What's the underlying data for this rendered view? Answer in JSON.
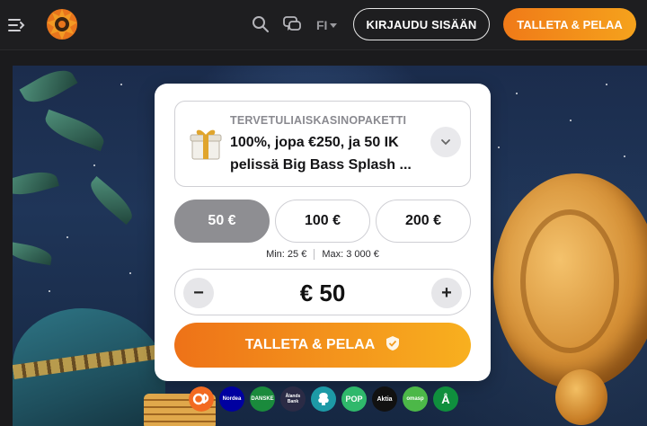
{
  "header": {
    "language": "FI",
    "login_label": "KIRJAUDU SISÄÄN",
    "cta_label": "TALLETA & PELAA",
    "icons": [
      "menu-icon",
      "logo",
      "search-icon",
      "chat-icon",
      "caret-down-icon"
    ]
  },
  "promo": {
    "eyebrow": "TERVETULIAISKASINOPAKETTI",
    "title": "100%, jopa €250, ja 50 IK pelissä Big Bass Splash ..."
  },
  "amounts": {
    "options": [
      "50 €",
      "100 €",
      "200 €"
    ],
    "selected": "50 €"
  },
  "limits": {
    "min": "Min: 25 €",
    "max": "Max: 3 000 €"
  },
  "stepper": {
    "minus": "−",
    "value": "€ 50",
    "plus": "+"
  },
  "cta": {
    "label": "TALLETA & PELAA"
  },
  "banks": [
    {
      "name": "OP",
      "label": "",
      "color": "#f26a21"
    },
    {
      "name": "Nordea",
      "label": "Nordea",
      "color": "#0000a0"
    },
    {
      "name": "Danske",
      "label": "DANSKE",
      "color": "#1a8a3c"
    },
    {
      "name": "Ålandsbanken",
      "label": "Ålands Bank",
      "color": "#2b2b45"
    },
    {
      "name": "S-Pankki",
      "label": "",
      "color": "#1d9aa6"
    },
    {
      "name": "POP",
      "label": "POP",
      "color": "#2fb86b"
    },
    {
      "name": "Aktia",
      "label": "Aktia",
      "color": "#111111"
    },
    {
      "name": "Omasp",
      "label": "omasp",
      "color": "#4cb848"
    },
    {
      "name": "Handelsbanken",
      "label": "Å",
      "color": "#0f8f3d"
    }
  ],
  "colors": {
    "accent_orange": "#f07a18",
    "accent_yellow": "#f8b01f",
    "selected_chip": "#8e8e92"
  }
}
